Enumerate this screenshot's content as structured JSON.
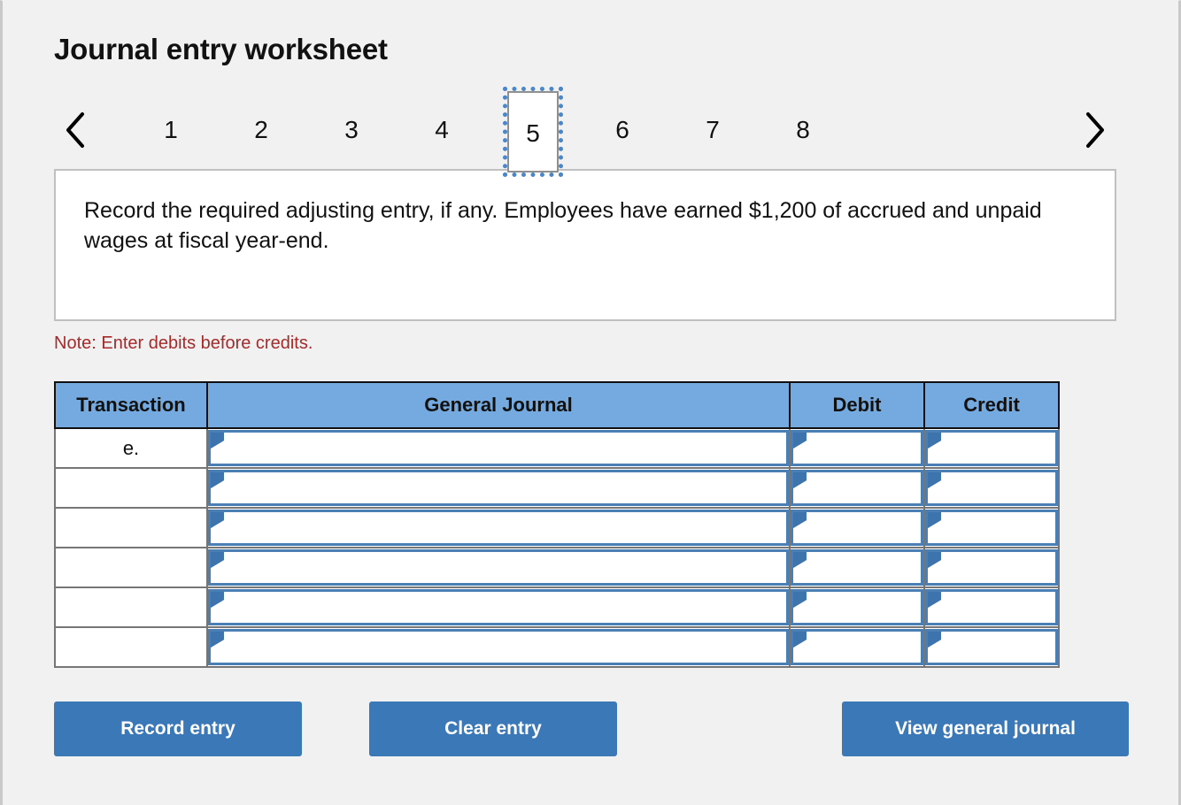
{
  "header": {
    "title": "Journal entry worksheet"
  },
  "pager": {
    "prev_icon": "chevron-left-icon",
    "next_icon": "chevron-right-icon",
    "pages": [
      "1",
      "2",
      "3",
      "4",
      "5",
      "6",
      "7",
      "8"
    ],
    "active_page": "5"
  },
  "instruction": {
    "text": "Record the required adjusting entry, if any. Employees have earned $1,200 of accrued and unpaid wages at fiscal year-end."
  },
  "note": {
    "text": "Note: Enter debits before credits."
  },
  "table": {
    "headers": {
      "transaction": "Transaction",
      "general_journal": "General Journal",
      "debit": "Debit",
      "credit": "Credit"
    },
    "rows": [
      {
        "transaction": "e.",
        "general_journal": "",
        "debit": "",
        "credit": ""
      },
      {
        "transaction": "",
        "general_journal": "",
        "debit": "",
        "credit": ""
      },
      {
        "transaction": "",
        "general_journal": "",
        "debit": "",
        "credit": ""
      },
      {
        "transaction": "",
        "general_journal": "",
        "debit": "",
        "credit": ""
      },
      {
        "transaction": "",
        "general_journal": "",
        "debit": "",
        "credit": ""
      },
      {
        "transaction": "",
        "general_journal": "",
        "debit": "",
        "credit": ""
      }
    ]
  },
  "actions": {
    "record_entry": "Record entry",
    "clear_entry": "Clear entry",
    "view_general_journal": "View general journal"
  },
  "colors": {
    "page_background": "#f1f1f1",
    "table_header_blue": "#74aae0",
    "button_blue": "#3b78b8",
    "note_red": "#a52a2a",
    "field_border_blue": "#4a7fb5",
    "active_tab_outline": "#4a86c8"
  }
}
